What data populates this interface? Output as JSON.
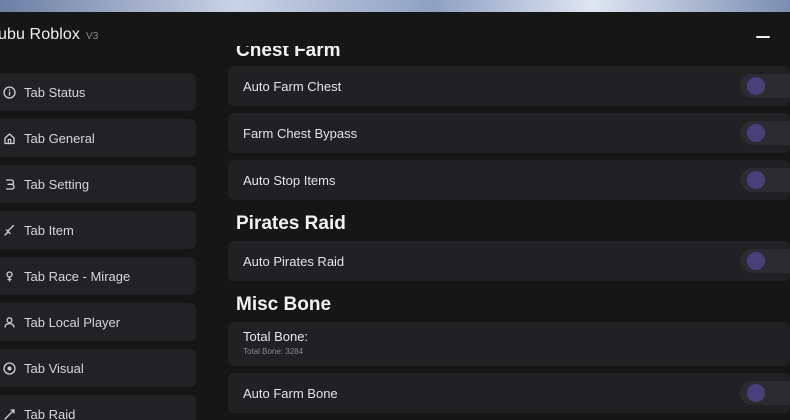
{
  "window": {
    "title": "ubu Roblox",
    "version": "V3"
  },
  "sidebar": {
    "items": [
      {
        "label": "Tab Status",
        "icon": "info-icon"
      },
      {
        "label": "Tab General",
        "icon": "home-icon"
      },
      {
        "label": "Tab Setting",
        "icon": "settings-icon"
      },
      {
        "label": "Tab Item",
        "icon": "sword-icon"
      },
      {
        "label": "Tab Race - Mirage",
        "icon": "race-icon"
      },
      {
        "label": "Tab Local Player",
        "icon": "user-icon"
      },
      {
        "label": "Tab Visual",
        "icon": "eye-icon"
      },
      {
        "label": "Tab Raid",
        "icon": "raid-icon"
      }
    ]
  },
  "main": {
    "chest_farm_title": "Chest Farm",
    "chest_farm_items": [
      "Auto Farm Chest",
      "Farm Chest Bypass",
      "Auto Stop Items"
    ],
    "pirates_raid_title": "Pirates Raid",
    "pirates_raid_items": [
      "Auto Pirates Raid"
    ],
    "misc_bone_title": "Misc Bone",
    "total_bone_label": "Total Bone:",
    "total_bone_value": "Total Bone: 3284",
    "misc_bone_items": [
      "Auto Farm Bone"
    ]
  },
  "colors": {
    "background": "#161617",
    "panel": "#212123",
    "toggle_track": "#2c2c30",
    "toggle_knob": "#4a3f7a"
  }
}
